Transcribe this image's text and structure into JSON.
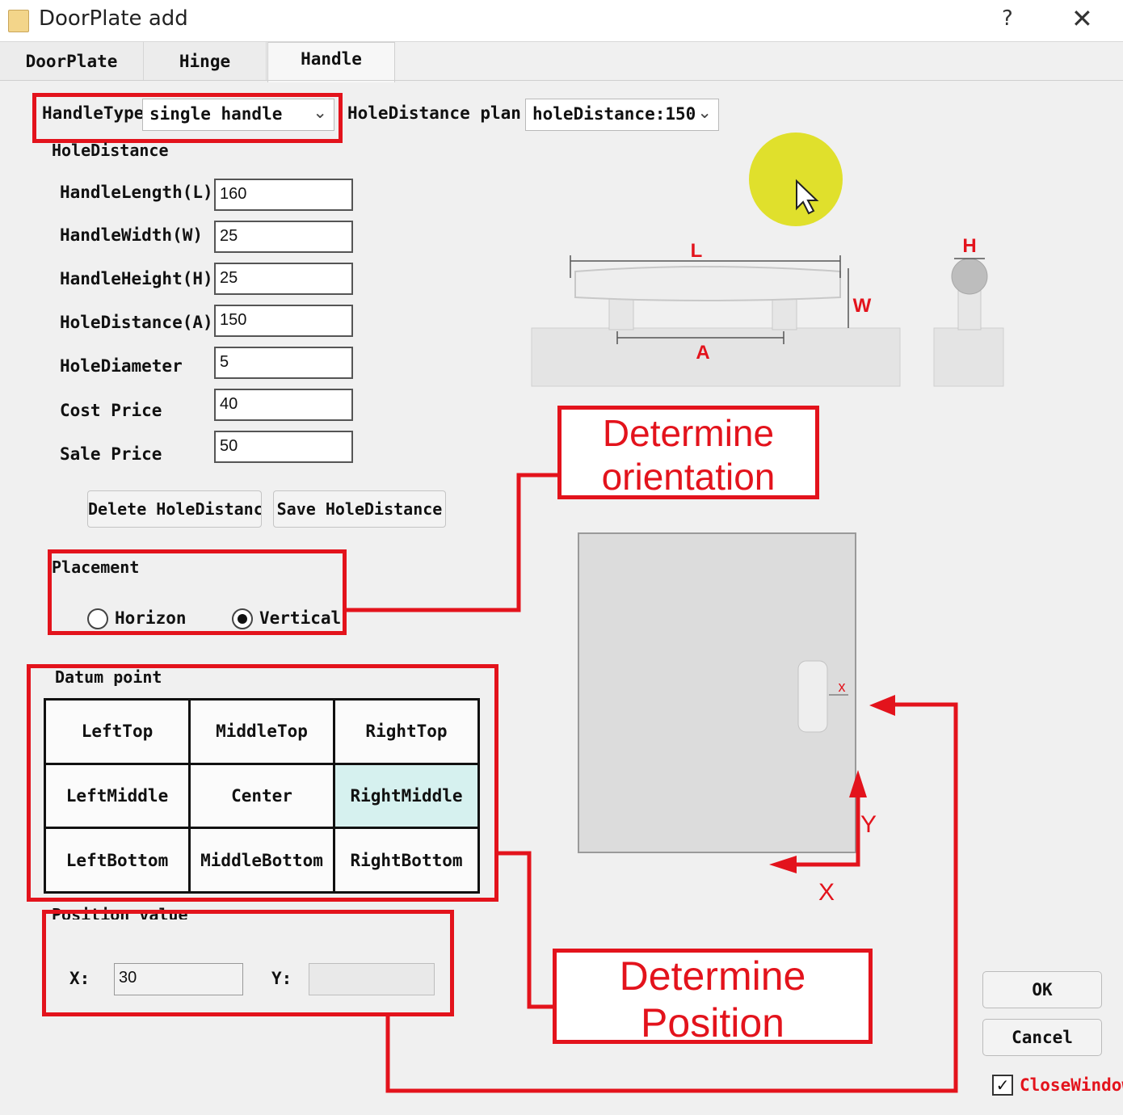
{
  "window": {
    "title": "DoorPlate add",
    "help_glyph": "?",
    "close_glyph": "✕"
  },
  "tabs": [
    "DoorPlate",
    "Hinge",
    "Handle"
  ],
  "handle_type": {
    "label": "HandleType",
    "value": "single handle"
  },
  "hole_distance_plan": {
    "label": "HoleDistance plan",
    "value": "holeDistance:150"
  },
  "group_label": "HoleDistance",
  "fields": [
    {
      "label": "HandleLength(L)",
      "value": "160"
    },
    {
      "label": "HandleWidth(W)",
      "value": "25"
    },
    {
      "label": "HandleHeight(H)",
      "value": "25"
    },
    {
      "label": "HoleDistance(A)",
      "value": "150"
    },
    {
      "label": "HoleDiameter",
      "value": "5"
    },
    {
      "label": "Cost Price",
      "value": "40"
    },
    {
      "label": "Sale Price",
      "value": "50"
    }
  ],
  "buttons": {
    "delete": "Delete HoleDistance",
    "save": "Save HoleDistance",
    "ok": "OK",
    "cancel": "Cancel"
  },
  "placement": {
    "label": "Placement",
    "options": [
      "Horizon",
      "Vertical"
    ],
    "selected": "Vertical"
  },
  "datum": {
    "label": "Datum point",
    "cells": [
      "LeftTop",
      "MiddleTop",
      "RightTop",
      "LeftMiddle",
      "Center",
      "RightMiddle",
      "LeftBottom",
      "MiddleBottom",
      "RightBottom"
    ],
    "selected": "RightMiddle"
  },
  "position": {
    "label": "Position value",
    "x_label": "X:",
    "x_value": "30",
    "y_label": "Y:",
    "y_value": ""
  },
  "diagram": {
    "L": "L",
    "W": "W",
    "A": "A",
    "H": "H",
    "x_small": "x",
    "axis_x": "X",
    "axis_y": "Y"
  },
  "annotations": {
    "orientation": [
      "Determine",
      "orientation"
    ],
    "position": [
      "Determine",
      "Position"
    ]
  },
  "close_window": {
    "label": "CloseWindow",
    "checked": true
  },
  "colors": {
    "annotation_red": "#e3131c",
    "selected_cell": "#d6f1ef",
    "cursor_highlight": "#dede16"
  }
}
